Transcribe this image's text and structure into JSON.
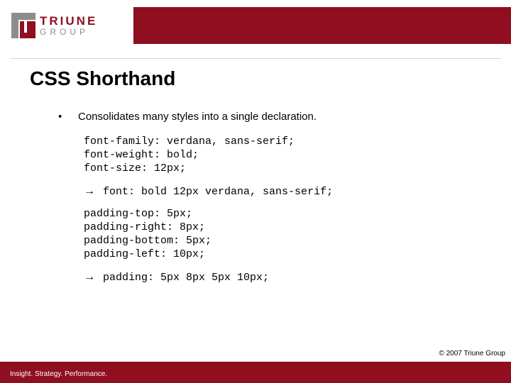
{
  "brand": {
    "name": "TRIUNE",
    "sub": "GROUP",
    "accent": "#8f0e1f"
  },
  "title": "CSS Shorthand",
  "bullet": "Consolidates many styles into a single declaration.",
  "code1": "font-family: verdana, sans-serif;\nfont-weight: bold;\nfont-size: 12px;",
  "arrow1": "font: bold 12px verdana, sans-serif;",
  "code2": "padding-top: 5px;\npadding-right: 8px;\npadding-bottom: 5px;\npadding-left: 10px;",
  "arrow2": "padding: 5px 8px 5px 10px;",
  "arrow_glyph": "→",
  "copyright": "© 2007 Triune Group",
  "tagline": "Insight. Strategy. Performance."
}
